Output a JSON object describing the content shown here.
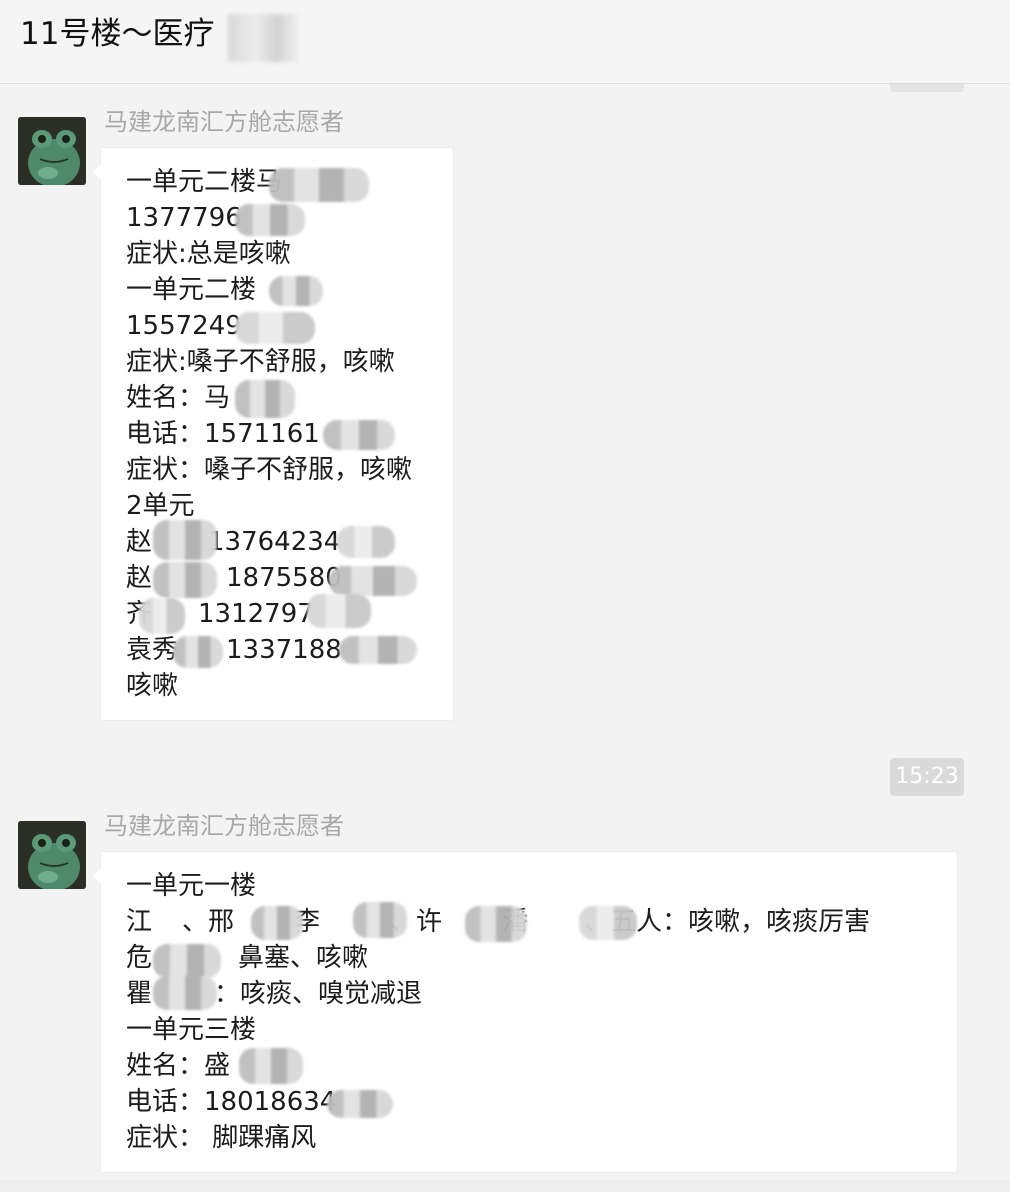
{
  "header": {
    "title": "11号楼～医疗"
  },
  "time_divider": "15:23",
  "messages": [
    {
      "sender": "马建龙南汇方舱志愿者",
      "lines": [
        "一单元二楼马",
        "1377796",
        "症状:总是咳嗽",
        "一单元二楼",
        "1557249",
        "症状:嗓子不舒服，咳嗽",
        "姓名：马",
        "电话：1571161",
        "症状：嗓子不舒服，咳嗽",
        "2单元",
        "赵",
        "赵",
        "齐",
        "袁秀",
        "咳嗽"
      ],
      "line_extras": {
        "zhao1_phone": "13764234",
        "zhao2_phone": "1875580",
        "qi_phone": "1312797",
        "yuan_phone": "1337188"
      }
    },
    {
      "sender": "马建龙南汇方舱志愿者",
      "lines": [
        "一单元一楼",
        "江",
        "危",
        "瞿",
        "一单元三楼",
        "姓名：盛",
        "电话：18018634",
        "症状：  脚踝痛风"
      ],
      "line_extras": {
        "row2_a": "、邢",
        "row2_b": "李",
        "row2_c": "、许",
        "row2_d": "潘",
        "row2_e": "、五人：咳嗽，咳痰厉害",
        "row3_tail": "鼻塞、咳嗽",
        "row4_tail": "：咳痰、嗅觉减退"
      }
    }
  ]
}
